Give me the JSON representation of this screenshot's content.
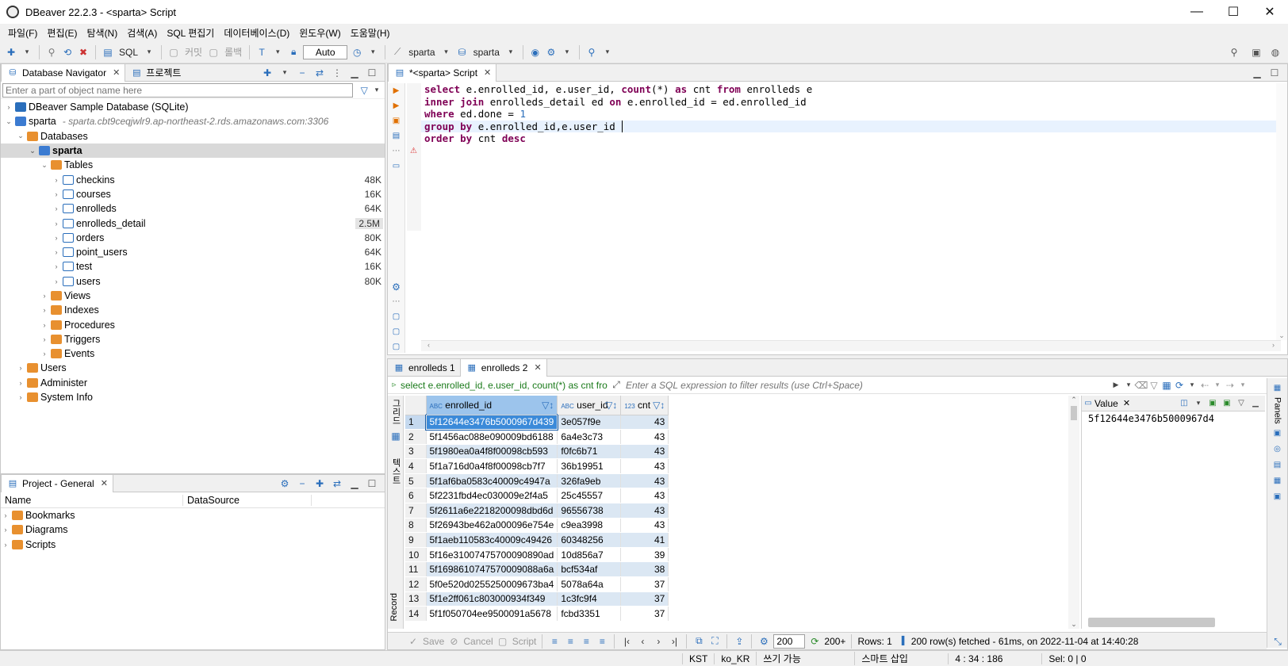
{
  "window": {
    "title": "DBeaver 22.2.3 - <sparta> Script",
    "minimize": "—",
    "maximize": "☐",
    "close": "✕"
  },
  "menu": [
    "파일(F)",
    "편집(E)",
    "탐색(N)",
    "검색(A)",
    "SQL 편집기",
    "데이터베이스(D)",
    "윈도우(W)",
    "도움말(H)"
  ],
  "toolbar": {
    "sql": "SQL",
    "commit": "커밋",
    "rollback": "롤백",
    "auto": "Auto",
    "datasource": "sparta",
    "schema": "sparta"
  },
  "navigator": {
    "tab1": "Database Navigator",
    "tab2": "프로젝트",
    "filter_placeholder": "Enter a part of object name here",
    "items": [
      {
        "label": "DBeaver Sample Database (SQLite)",
        "level": 0,
        "icon": "dbsample",
        "arrow": "›"
      },
      {
        "label": "sparta",
        "detail": "- sparta.cbt9ceqjwlr9.ap-northeast-2.rds.amazonaws.com:3306",
        "level": 0,
        "icon": "db",
        "arrow": "⌄"
      },
      {
        "label": "Databases",
        "level": 1,
        "icon": "folder",
        "arrow": "⌄"
      },
      {
        "label": "sparta",
        "level": 2,
        "icon": "db",
        "arrow": "⌄",
        "selected": true
      },
      {
        "label": "Tables",
        "level": 3,
        "icon": "folder",
        "arrow": "⌄"
      },
      {
        "label": "checkins",
        "level": 4,
        "icon": "table",
        "arrow": "›",
        "size": "48K"
      },
      {
        "label": "courses",
        "level": 4,
        "icon": "table",
        "arrow": "›",
        "size": "16K"
      },
      {
        "label": "enrolleds",
        "level": 4,
        "icon": "table",
        "arrow": "›",
        "size": "64K"
      },
      {
        "label": "enrolleds_detail",
        "level": 4,
        "icon": "table",
        "arrow": "›",
        "size": "2.5M"
      },
      {
        "label": "orders",
        "level": 4,
        "icon": "table",
        "arrow": "›",
        "size": "80K"
      },
      {
        "label": "point_users",
        "level": 4,
        "icon": "table",
        "arrow": "›",
        "size": "64K"
      },
      {
        "label": "test",
        "level": 4,
        "icon": "table",
        "arrow": "›",
        "size": "16K"
      },
      {
        "label": "users",
        "level": 4,
        "icon": "table",
        "arrow": "›",
        "size": "80K"
      },
      {
        "label": "Views",
        "level": 3,
        "icon": "folder",
        "arrow": "›"
      },
      {
        "label": "Indexes",
        "level": 3,
        "icon": "folder",
        "arrow": "›"
      },
      {
        "label": "Procedures",
        "level": 3,
        "icon": "folder",
        "arrow": "›"
      },
      {
        "label": "Triggers",
        "level": 3,
        "icon": "folder",
        "arrow": "›"
      },
      {
        "label": "Events",
        "level": 3,
        "icon": "folder",
        "arrow": "›"
      },
      {
        "label": "Users",
        "level": 1,
        "icon": "folder",
        "arrow": "›"
      },
      {
        "label": "Administer",
        "level": 1,
        "icon": "folder",
        "arrow": "›"
      },
      {
        "label": "System Info",
        "level": 1,
        "icon": "folder",
        "arrow": "›"
      }
    ]
  },
  "project": {
    "tab": "Project - General",
    "col_name": "Name",
    "col_datasource": "DataSource",
    "items": [
      "Bookmarks",
      "Diagrams",
      "Scripts"
    ]
  },
  "editor": {
    "tab": "*<sparta> Script",
    "lines": [
      [
        {
          "t": "select",
          "k": 1
        },
        {
          "t": " e.enrolled_id, e.user_id, "
        },
        {
          "t": "count",
          "k": 1
        },
        {
          "t": "(*) "
        },
        {
          "t": "as",
          "k": 1
        },
        {
          "t": " cnt "
        },
        {
          "t": "from",
          "k": 1
        },
        {
          "t": " enrolleds e"
        }
      ],
      [
        {
          "t": "inner join",
          "k": 1
        },
        {
          "t": " enrolleds_detail ed "
        },
        {
          "t": "on",
          "k": 1
        },
        {
          "t": " e.enrolled_id = ed.enrolled_id"
        }
      ],
      [
        {
          "t": "where",
          "k": 1
        },
        {
          "t": " ed.done = "
        },
        {
          "t": "1",
          "n": 1
        }
      ],
      [
        {
          "t": "group by",
          "k": 1
        },
        {
          "t": " e.enrolled_id,e.user_id "
        }
      ],
      [
        {
          "t": "order by",
          "k": 1
        },
        {
          "t": " cnt "
        },
        {
          "t": "desc",
          "k": 1
        }
      ]
    ]
  },
  "results": {
    "tab1": "enrolleds 1",
    "tab2": "enrolleds 2",
    "query_preview": "select e.enrolled_id, e.user_id, count(*) as cnt fro",
    "filter_placeholder": "Enter a SQL expression to filter results (use Ctrl+Space)",
    "side_tabs": [
      "그리드",
      "텍스트",
      "Record"
    ],
    "columns": [
      "enrolled_id",
      "user_id",
      "cnt"
    ],
    "col_types": [
      "ABC",
      "ABC",
      "123"
    ],
    "rows": [
      [
        "1",
        "5f12644e3476b5000967d439",
        "3e057f9e",
        "43"
      ],
      [
        "2",
        "5f1456ac088e090009bd6188",
        "6a4e3c73",
        "43"
      ],
      [
        "3",
        "5f1980ea0a4f8f00098cb593",
        "f0fc6b71",
        "43"
      ],
      [
        "4",
        "5f1a716d0a4f8f00098cb7f7",
        "36b19951",
        "43"
      ],
      [
        "5",
        "5f1af6ba0583c40009c4947a",
        "326fa9eb",
        "43"
      ],
      [
        "6",
        "5f2231fbd4ec030009e2f4a5",
        "25c45557",
        "43"
      ],
      [
        "7",
        "5f2611a6e2218200098dbd6d",
        "96556738",
        "43"
      ],
      [
        "8",
        "5f26943be462a000096e754e",
        "c9ea3998",
        "43"
      ],
      [
        "9",
        "5f1aeb110583c40009c49426",
        "60348256",
        "41"
      ],
      [
        "10",
        "5f16e31007475700090890ad",
        "10d856a7",
        "39"
      ],
      [
        "11",
        "5f1698610747570009088a6a",
        "bcf534af",
        "38"
      ],
      [
        "12",
        "5f0e520d0255250009673ba4",
        "5078a64a",
        "37"
      ],
      [
        "13",
        "5f1e2ff061c803000934f349",
        "1c3fc9f4",
        "37"
      ],
      [
        "14",
        "5f1f050704ee9500091a5678",
        "fcbd3351",
        "37"
      ]
    ],
    "value_panel": {
      "title": "Value",
      "value": "5f12644e3476b5000967d4"
    },
    "panels_label": "Panels",
    "bottom": {
      "save": "Save",
      "cancel": "Cancel",
      "script": "Script",
      "fetch_size": "200",
      "fetch_more": "200+",
      "rows": "Rows: 1",
      "fetched": "200 row(s) fetched - 61ms, on 2022-11-04 at 14:40:28"
    }
  },
  "status": {
    "tz": "KST",
    "locale": "ko_KR",
    "mode": "쓰기 가능",
    "insert": "스마트 삽입",
    "pos": "4 : 34 : 186",
    "sel": "Sel: 0 | 0"
  },
  "colors": {
    "selection": "#d9e8f7",
    "cell_selected": "#3b8ad9",
    "keyword": "#7f0055"
  }
}
